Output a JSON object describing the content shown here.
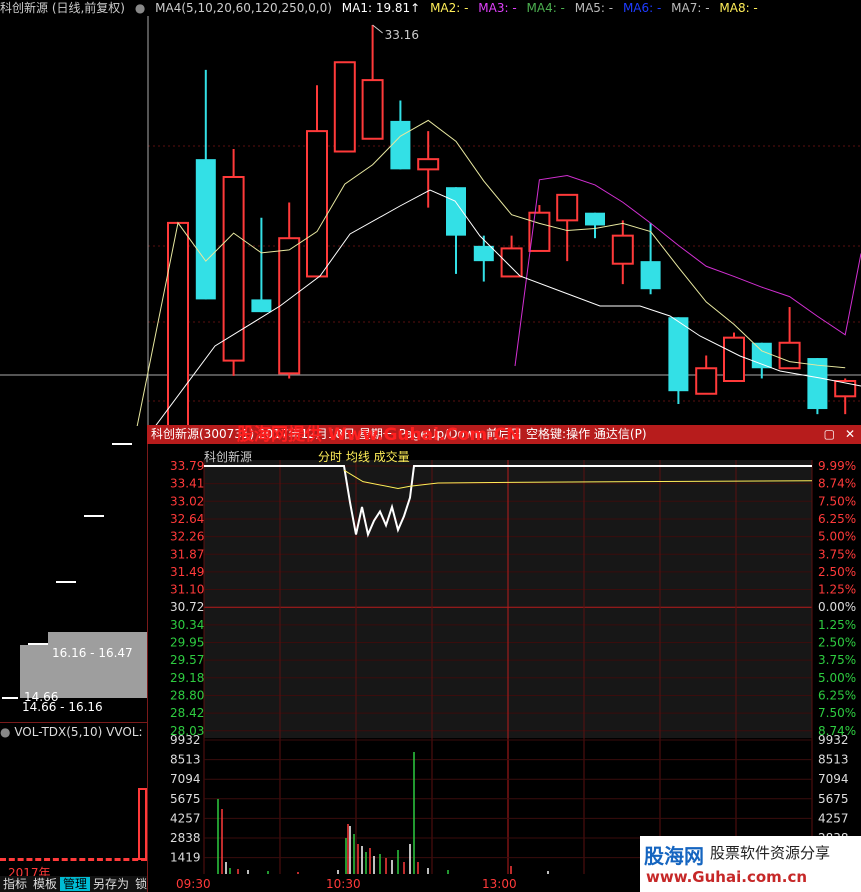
{
  "topbar": {
    "stock": "科创新源 (日线,前复权)",
    "ma4": "MA4(5,10,20,60,120,250,0,0)",
    "ma1": "MA1: 19.81↑",
    "ma2": "MA2: -",
    "ma3": "MA3: -",
    "ma4v": "MA4: -",
    "ma5": "MA5: -",
    "ma6": "MA6: -",
    "ma7": "MA7: -",
    "ma8": "MA8: -"
  },
  "colors": {
    "up": "#ff3a3a",
    "down": "#33e0e6",
    "ma1": "#e8e8a0",
    "ma2": "#d22fd2",
    "bg": "#000000",
    "grid": "#7a1a1a",
    "titlebar": "#b71c1c"
  },
  "kline": {
    "high_label": "33.16",
    "candles": [
      {
        "o": 17.0,
        "c": 25.4,
        "h": 25.4,
        "l": 17.0
      },
      {
        "o": 27.9,
        "c": 22.4,
        "h": 31.4,
        "l": 22.4
      },
      {
        "o": 20.0,
        "c": 27.2,
        "h": 28.3,
        "l": 19.4
      },
      {
        "o": 22.4,
        "c": 21.9,
        "h": 25.6,
        "l": 21.9
      },
      {
        "o": 19.5,
        "c": 24.8,
        "h": 26.2,
        "l": 19.3
      },
      {
        "o": 23.3,
        "c": 29.0,
        "h": 30.8,
        "l": 23.3
      },
      {
        "o": 28.2,
        "c": 31.7,
        "h": 31.7,
        "l": 28.2
      },
      {
        "o": 28.7,
        "c": 31.0,
        "h": 33.16,
        "l": 28.7
      },
      {
        "o": 29.4,
        "c": 27.5,
        "h": 30.2,
        "l": 27.5
      },
      {
        "o": 27.5,
        "c": 27.9,
        "h": 29.0,
        "l": 26.0
      },
      {
        "o": 26.8,
        "c": 24.9,
        "h": 26.8,
        "l": 23.4
      },
      {
        "o": 24.5,
        "c": 23.9,
        "h": 24.9,
        "l": 23.1
      },
      {
        "o": 23.3,
        "c": 24.4,
        "h": 24.9,
        "l": 23.3
      },
      {
        "o": 24.3,
        "c": 25.8,
        "h": 26.1,
        "l": 24.3
      },
      {
        "o": 25.5,
        "c": 26.5,
        "h": 26.5,
        "l": 23.9
      },
      {
        "o": 25.8,
        "c": 25.3,
        "h": 25.8,
        "l": 24.8
      },
      {
        "o": 23.8,
        "c": 24.9,
        "h": 25.5,
        "l": 23.0
      },
      {
        "o": 23.9,
        "c": 22.8,
        "h": 25.4,
        "l": 22.6
      },
      {
        "o": 21.7,
        "c": 18.8,
        "h": 21.7,
        "l": 18.3
      },
      {
        "o": 18.7,
        "c": 19.7,
        "h": 20.2,
        "l": 18.7
      },
      {
        "o": 19.2,
        "c": 20.9,
        "h": 21.1,
        "l": 19.2
      },
      {
        "o": 20.7,
        "c": 19.7,
        "h": 20.7,
        "l": 19.3
      },
      {
        "o": 19.7,
        "c": 20.7,
        "h": 22.1,
        "l": 19.7
      },
      {
        "o": 20.1,
        "c": 18.1,
        "h": 20.1,
        "l": 17.9
      },
      {
        "o": 18.6,
        "c": 19.2,
        "h": 19.3,
        "l": 17.9
      }
    ]
  },
  "left_labels": {
    "range1": "16.16 - 16.47",
    "range2_low": "14.66",
    "range2": "14.66 - 16.16",
    "year": "2017年"
  },
  "vol": {
    "title": "VOL-TDX(5,10)",
    "sub": "VVOL:"
  },
  "popup": {
    "title": "科创新源(300731) 2017年12月18日 星期一 PageUp/Down:前后日 空格键:操作 通达信(P)",
    "watermark": "股海网提供 Www.Guhai.Com.CN",
    "inner_label": "科创新源",
    "inner_label2": "分时 均线 成交量"
  },
  "price_axis": {
    "left": [
      "33.79",
      "33.41",
      "33.02",
      "32.64",
      "32.26",
      "31.87",
      "31.49",
      "31.10",
      "30.72",
      "30.34",
      "29.95",
      "29.57",
      "29.18",
      "28.80",
      "28.42",
      "28.03"
    ],
    "right": [
      "9.99%",
      "8.74%",
      "7.50%",
      "6.25%",
      "5.00%",
      "3.75%",
      "2.50%",
      "1.25%",
      "0.00%",
      "1.25%",
      "2.50%",
      "3.75%",
      "5.00%",
      "6.25%",
      "7.50%",
      "8.74%"
    ]
  },
  "vol_axis": {
    "labels": [
      "9932",
      "8513",
      "7094",
      "5675",
      "4257",
      "2838",
      "1419"
    ]
  },
  "time_axis": [
    "09:30",
    "10:30",
    "13:00"
  ],
  "bottom_tabs": [
    "指标",
    "模板",
    "管理",
    "另存为",
    "锁"
  ],
  "logo": {
    "name": "股海网",
    "slogan": "股票软件资源分享",
    "url": "www.Guhai.com.cn"
  }
}
